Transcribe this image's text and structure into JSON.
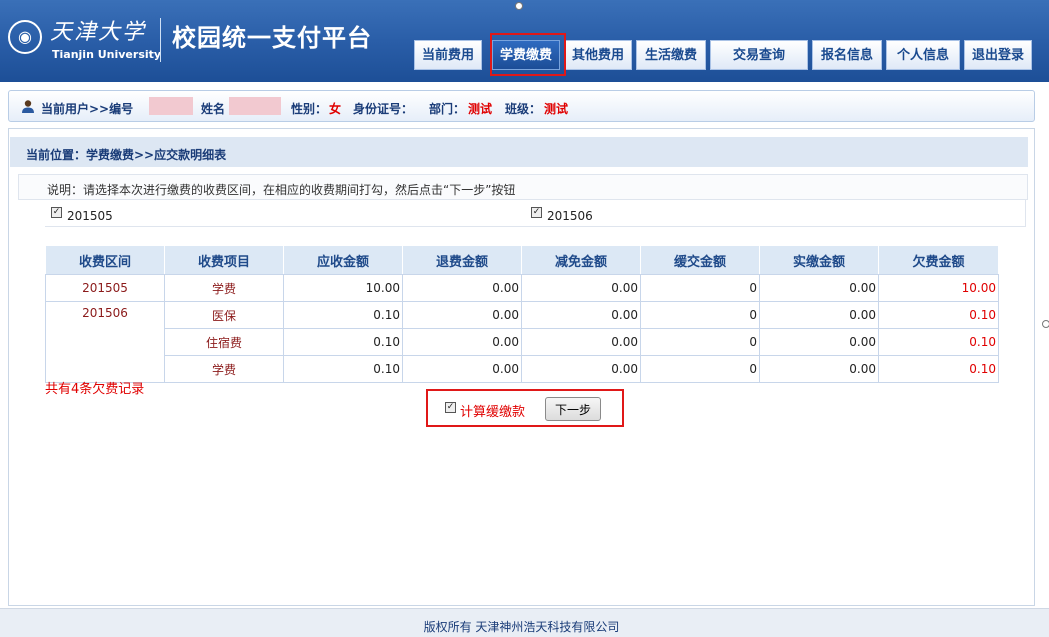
{
  "header": {
    "university_cn": "天津大学",
    "university_en": "Tianjin University",
    "site_title": "校园统一支付平台",
    "nav": [
      "当前费用",
      "学费缴费",
      "其他费用",
      "生活缴费",
      "交易查询",
      "报名信息",
      "个人信息",
      "退出登录"
    ],
    "active_tab": "学费缴费"
  },
  "userbar": {
    "current_user": "当前用户>>编号",
    "name_label": "姓名",
    "gender_label": "性别：",
    "gender_value": "女",
    "id_label": "身份证号：",
    "dept_label": "部门：",
    "dept_value": "测试",
    "class_label": "班级：",
    "class_value": "测试"
  },
  "breadcrumb": "当前位置：学费缴费>>应交款明细表",
  "note": "说明：请选择本次进行缴费的收费区间，在相应的收费期间打勾，然后点击“下一步”按钮",
  "periods": [
    "201505",
    "201506"
  ],
  "table": {
    "headers": [
      "收费区间",
      "收费项目",
      "应收金额",
      "退费金额",
      "减免金额",
      "缓交金额",
      "实缴金额",
      "欠费金额"
    ],
    "rows": [
      [
        "201505",
        "学费",
        "10.00",
        "0.00",
        "0.00",
        "0",
        "0.00",
        "10.00"
      ],
      [
        "201506",
        "医保",
        "0.10",
        "0.00",
        "0.00",
        "0",
        "0.00",
        "0.10"
      ],
      [
        "",
        "住宿费",
        "0.10",
        "0.00",
        "0.00",
        "0",
        "0.00",
        "0.10"
      ],
      [
        "",
        "学费",
        "0.10",
        "0.00",
        "0.00",
        "0",
        "0.00",
        "0.10"
      ]
    ]
  },
  "summary": "共有4条欠费记录",
  "calc_label": "计算缓缴款",
  "next_button": "下一步",
  "footer": "版权所有 天津神州浩天科技有限公司",
  "colors": {
    "header_blue": "#2a5ea8",
    "alert_red": "#e00000",
    "highlight_red": "#e01818"
  }
}
